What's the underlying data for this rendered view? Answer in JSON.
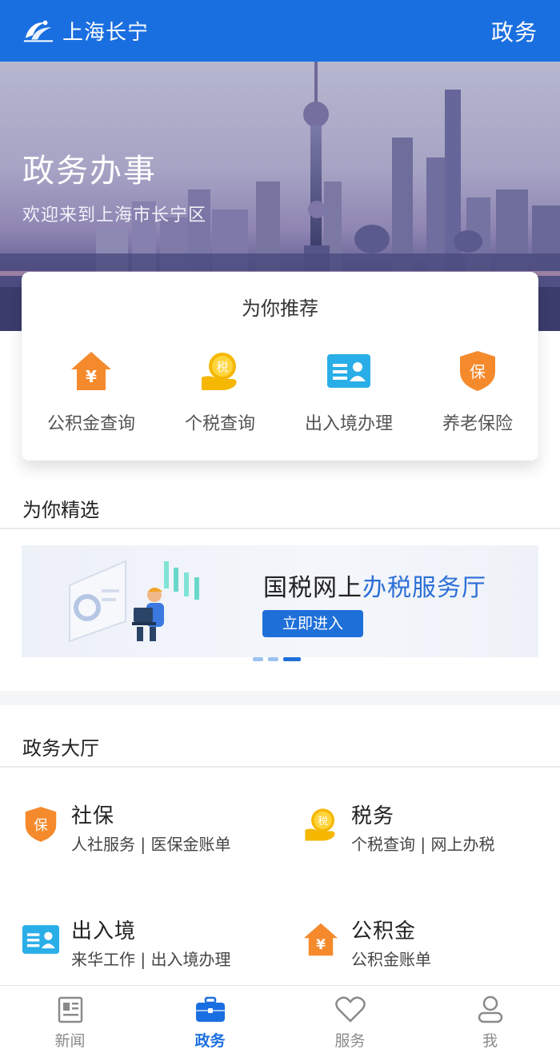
{
  "appbar": {
    "title": "上海长宁",
    "right": "政务"
  },
  "hero": {
    "title": "政务办事",
    "subtitle": "欢迎来到上海市长宁区"
  },
  "recommend": {
    "title": "为你推荐",
    "items": [
      {
        "label": "公积金查询",
        "icon": "house-yuan-icon"
      },
      {
        "label": "个税查询",
        "icon": "tax-coin-icon"
      },
      {
        "label": "出入境办理",
        "icon": "id-card-icon"
      },
      {
        "label": "养老保险",
        "icon": "shield-bao-icon"
      }
    ]
  },
  "featured": {
    "title": "为你精选",
    "banner": {
      "title_part1": "国税网上",
      "title_part2": "办税服务厅",
      "button": "立即进入"
    },
    "dots_count": 3,
    "active_dot": 2
  },
  "hall": {
    "title": "政务大厅",
    "items": [
      {
        "name": "社保",
        "desc": "人社服务 | 医保金账单",
        "icon": "shield-bao-icon"
      },
      {
        "name": "税务",
        "desc": "个税查询 | 网上办税",
        "icon": "tax-coin-icon"
      },
      {
        "name": "出入境",
        "desc": "来华工作 | 出入境办理",
        "icon": "id-card-icon"
      },
      {
        "name": "公积金",
        "desc": "公积金账单",
        "icon": "house-yuan-icon"
      }
    ]
  },
  "bottomnav": {
    "items": [
      {
        "label": "新闻",
        "icon": "news-icon"
      },
      {
        "label": "政务",
        "icon": "briefcase-icon",
        "active": true
      },
      {
        "label": "服务",
        "icon": "heart-icon"
      },
      {
        "label": "我",
        "icon": "user-icon"
      }
    ]
  },
  "colors": {
    "primary": "#1a6fe0",
    "orange": "#f58a2d",
    "yellow": "#f5b700",
    "cyan": "#29aee8"
  }
}
